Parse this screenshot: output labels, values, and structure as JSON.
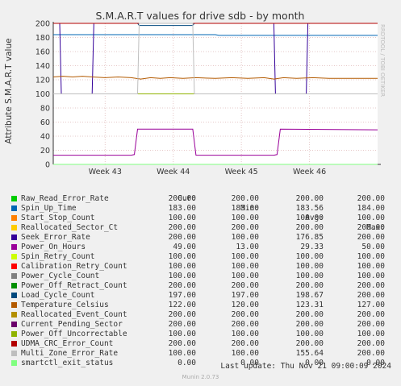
{
  "chart_data": {
    "type": "line",
    "title": "S.M.A.R.T values for drive sdb - by month",
    "ylabel": "Attribute S.M.A.R.T value",
    "xlabel": "",
    "ylim": [
      0,
      200
    ],
    "yticks": [
      0,
      20,
      40,
      60,
      80,
      100,
      120,
      140,
      160,
      180,
      200
    ],
    "xticks": [
      "Week 43",
      "Week 44",
      "Week 45",
      "Week 46"
    ],
    "grid": true,
    "series": [
      {
        "name": "Raw_Read_Error_Rate",
        "color": "#00cc00",
        "cur": "200.00",
        "min": "200.00",
        "avg": "200.00",
        "max": "200.00",
        "points": [
          [
            0,
            200
          ],
          [
            1,
            200
          ]
        ]
      },
      {
        "name": "Spin_Up_Time",
        "color": "#0066b3",
        "cur": "183.00",
        "min": "183.00",
        "avg": "183.56",
        "max": "184.00",
        "points": [
          [
            0,
            184
          ],
          [
            0.5,
            184
          ],
          [
            0.51,
            183
          ],
          [
            1,
            183
          ]
        ]
      },
      {
        "name": "Start_Stop_Count",
        "color": "#ff8000",
        "cur": "100.00",
        "min": "100.00",
        "avg": "100.00",
        "max": "100.00",
        "points": [
          [
            0,
            100
          ],
          [
            1,
            100
          ]
        ]
      },
      {
        "name": "Reallocated_Sector_Ct",
        "color": "#ffcc00",
        "cur": "200.00",
        "min": "200.00",
        "avg": "200.00",
        "max": "200.00",
        "points": [
          [
            0,
            200
          ],
          [
            1,
            200
          ]
        ]
      },
      {
        "name": "Seek_Error_Rate",
        "color": "#330099",
        "cur": "200.00",
        "min": "100.00",
        "avg": "176.85",
        "max": "200.00",
        "points": [
          [
            0,
            200
          ],
          [
            0.02,
            200
          ],
          [
            0.025,
            100
          ],
          [
            0.12,
            100
          ],
          [
            0.125,
            200
          ],
          [
            0.68,
            200
          ],
          [
            0.685,
            100
          ],
          [
            0.78,
            100
          ],
          [
            0.785,
            200
          ],
          [
            1,
            200
          ]
        ]
      },
      {
        "name": "Power_On_Hours",
        "color": "#990099",
        "cur": "49.00",
        "min": "13.00",
        "avg": "29.33",
        "max": "50.00",
        "points": [
          [
            0,
            13
          ],
          [
            0.24,
            13
          ],
          [
            0.25,
            14
          ],
          [
            0.26,
            50
          ],
          [
            0.43,
            50
          ],
          [
            0.44,
            13
          ],
          [
            0.68,
            13
          ],
          [
            0.69,
            14
          ],
          [
            0.7,
            50
          ],
          [
            1,
            49
          ]
        ]
      },
      {
        "name": "Spin_Retry_Count",
        "color": "#ccff00",
        "cur": "100.00",
        "min": "100.00",
        "avg": "100.00",
        "max": "100.00",
        "points": [
          [
            0,
            100
          ],
          [
            1,
            100
          ]
        ]
      },
      {
        "name": "Calibration_Retry_Count",
        "color": "#ff0000",
        "cur": "100.00",
        "min": "100.00",
        "avg": "100.00",
        "max": "100.00",
        "points": [
          [
            0,
            100
          ],
          [
            1,
            100
          ]
        ]
      },
      {
        "name": "Power_Cycle_Count",
        "color": "#808080",
        "cur": "100.00",
        "min": "100.00",
        "avg": "100.00",
        "max": "100.00",
        "points": [
          [
            0,
            100
          ],
          [
            1,
            100
          ]
        ]
      },
      {
        "name": "Power_Off_Retract_Count",
        "color": "#008f00",
        "cur": "200.00",
        "min": "200.00",
        "avg": "200.00",
        "max": "200.00",
        "points": [
          [
            0,
            200
          ],
          [
            1,
            200
          ]
        ]
      },
      {
        "name": "Load_Cycle_Count",
        "color": "#00487d",
        "cur": "197.00",
        "min": "197.00",
        "avg": "198.67",
        "max": "200.00",
        "points": [
          [
            0,
            200
          ],
          [
            0.26,
            200
          ],
          [
            0.265,
            197
          ],
          [
            0.43,
            197
          ],
          [
            0.435,
            200
          ],
          [
            1,
            200
          ]
        ]
      },
      {
        "name": "Temperature_Celsius",
        "color": "#b35a00",
        "cur": "122.00",
        "min": "120.00",
        "avg": "123.31",
        "max": "127.00",
        "points": [
          [
            0,
            124
          ],
          [
            0.03,
            125
          ],
          [
            0.06,
            124
          ],
          [
            0.09,
            125
          ],
          [
            0.12,
            124
          ],
          [
            0.16,
            123
          ],
          [
            0.2,
            124
          ],
          [
            0.24,
            123
          ],
          [
            0.27,
            121
          ],
          [
            0.3,
            123
          ],
          [
            0.33,
            122
          ],
          [
            0.36,
            123
          ],
          [
            0.4,
            122
          ],
          [
            0.44,
            123
          ],
          [
            0.5,
            122
          ],
          [
            0.55,
            123
          ],
          [
            0.6,
            122
          ],
          [
            0.65,
            123
          ],
          [
            0.68,
            121
          ],
          [
            0.71,
            123
          ],
          [
            0.75,
            122
          ],
          [
            0.8,
            123
          ],
          [
            0.85,
            122
          ],
          [
            0.9,
            122
          ],
          [
            0.95,
            122
          ],
          [
            1,
            122
          ]
        ]
      },
      {
        "name": "Reallocated_Event_Count",
        "color": "#b38f00",
        "cur": "200.00",
        "min": "200.00",
        "avg": "200.00",
        "max": "200.00",
        "points": [
          [
            0,
            200
          ],
          [
            1,
            200
          ]
        ]
      },
      {
        "name": "Current_Pending_Sector",
        "color": "#6b006b",
        "cur": "200.00",
        "min": "200.00",
        "avg": "200.00",
        "max": "200.00",
        "points": [
          [
            0,
            200
          ],
          [
            1,
            200
          ]
        ]
      },
      {
        "name": "Power_Off_Uncorrectable",
        "color": "#8fb300",
        "cur": "100.00",
        "min": "100.00",
        "avg": "100.00",
        "max": "100.00",
        "points": [
          [
            0,
            100
          ],
          [
            1,
            100
          ]
        ]
      },
      {
        "name": "UDMA_CRC_Error_Count",
        "color": "#b30000",
        "cur": "200.00",
        "min": "200.00",
        "avg": "200.00",
        "max": "200.00",
        "points": [
          [
            0,
            200
          ],
          [
            1,
            200
          ]
        ]
      },
      {
        "name": "Multi_Zone_Error_Rate",
        "color": "#bebebe",
        "cur": "100.00",
        "min": "100.00",
        "avg": "155.64",
        "max": "200.00",
        "points": [
          [
            0,
            100
          ],
          [
            0.26,
            100
          ],
          [
            0.265,
            200
          ],
          [
            0.43,
            200
          ],
          [
            0.435,
            100
          ],
          [
            1,
            100
          ]
        ]
      },
      {
        "name": "smartctl_exit_status",
        "color": "#80ff80",
        "cur": "0.00",
        "min": "0.00",
        "avg": "0.00",
        "max": "0.00",
        "points": [
          [
            0,
            0
          ],
          [
            1,
            0
          ]
        ]
      }
    ]
  },
  "legend_headers": {
    "cur": "Cur:",
    "min": "Min:",
    "avg": "Avg:",
    "max": "Max:"
  },
  "last_update": "Last update: Thu Nov 21 09:00:09 2024",
  "footer": "Munin 2.0.73",
  "side_label": "RRDTOOL / TOBI OETIKER"
}
